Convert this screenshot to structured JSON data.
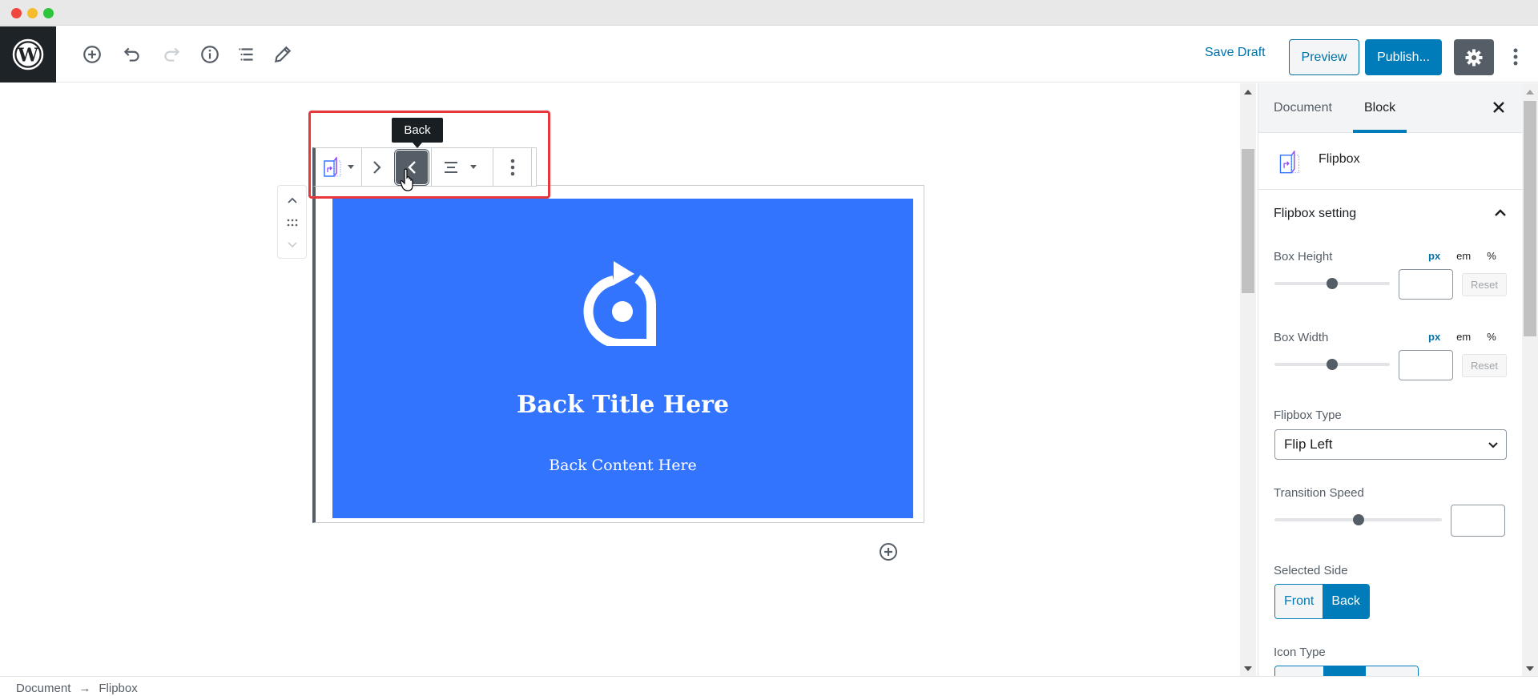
{
  "window": {
    "controls": [
      "close",
      "minimize",
      "maximize"
    ]
  },
  "header": {
    "logo": "wordpress-logo",
    "tools": [
      {
        "name": "add-block",
        "icon": "plus-circle-icon"
      },
      {
        "name": "undo",
        "icon": "undo-icon"
      },
      {
        "name": "redo",
        "icon": "redo-icon",
        "disabled": true
      },
      {
        "name": "content-structure",
        "icon": "info-icon"
      },
      {
        "name": "block-navigation",
        "icon": "list-view-icon"
      },
      {
        "name": "tools",
        "icon": "pencil-icon"
      }
    ],
    "save_draft": "Save Draft",
    "preview": "Preview",
    "publish": "Publish...",
    "settings_icon": "gear-icon",
    "more_icon": "vertical-ellipsis-icon"
  },
  "block_toolbar": {
    "tooltip": "Back",
    "buttons": [
      {
        "name": "block-type",
        "icon": "flipbox-icon",
        "has_dropdown": true
      },
      {
        "name": "front",
        "icon": "chevron-right-icon"
      },
      {
        "name": "back",
        "icon": "chevron-left-icon",
        "active": true
      },
      {
        "name": "align",
        "icon": "align-center-icon",
        "has_dropdown": true
      },
      {
        "name": "more-options",
        "icon": "vertical-ellipsis-icon"
      }
    ]
  },
  "flipbox": {
    "icon": "rotate-icon",
    "title": "Back Title Here",
    "content": "Back Content Here",
    "background_color": "#3374ff"
  },
  "sidebar": {
    "tabs": [
      {
        "label": "Document",
        "active": false
      },
      {
        "label": "Block",
        "active": true
      }
    ],
    "block_name": "Flipbox",
    "section_title": "Flipbox setting",
    "box_height": {
      "label": "Box Height",
      "units": [
        "px",
        "em",
        "%"
      ],
      "active_unit": "px",
      "value": "",
      "reset": "Reset"
    },
    "box_width": {
      "label": "Box Width",
      "units": [
        "px",
        "em",
        "%"
      ],
      "active_unit": "px",
      "value": "",
      "reset": "Reset"
    },
    "flipbox_type": {
      "label": "Flipbox Type",
      "selected": "Flip Left"
    },
    "transition_speed": {
      "label": "Transition Speed",
      "value": ""
    },
    "selected_side": {
      "label": "Selected Side",
      "options": [
        "Front",
        "Back"
      ],
      "selected": "Back"
    },
    "icon_type": {
      "label": "Icon Type",
      "selected_index": 1
    }
  },
  "footer": {
    "breadcrumb": [
      "Document",
      "Flipbox"
    ],
    "separator": "→"
  }
}
